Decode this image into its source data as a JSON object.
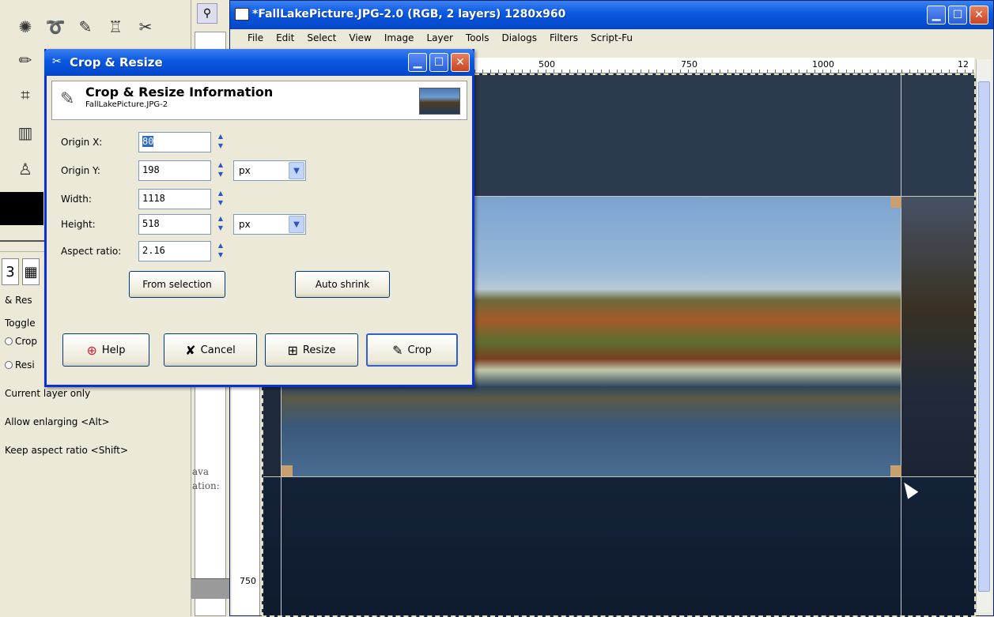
{
  "image_window": {
    "title": "*FallLakePicture.JPG-2.0 (RGB, 2 layers) 1280x960",
    "menu": [
      "File",
      "Edit",
      "Select",
      "View",
      "Image",
      "Layer",
      "Tools",
      "Dialogs",
      "Filters",
      "Script-Fu"
    ],
    "ruler_h": [
      "500",
      "750",
      "1000",
      "12"
    ],
    "ruler_v": "750"
  },
  "toolbox": {
    "tool_options": {
      "tab_label": "& Res",
      "toggle_label": "Toggle",
      "crop_label": "Crop",
      "resize_label": "Resi",
      "current_layer_only": "Current layer only",
      "allow_enlarging": "Allow enlarging  <Alt>",
      "keep_aspect": "Keep aspect ratio  <Shift>"
    }
  },
  "side_fragments": {
    "line1": "ava",
    "line2": "ation:"
  },
  "dialog": {
    "title": "Crop & Resize",
    "header_title": "Crop & Resize Information",
    "header_subtitle": "FallLakePicture.JPG-2",
    "fields": [
      {
        "label": "Origin X:",
        "value": "80"
      },
      {
        "label": "Origin Y:",
        "value": "198",
        "unit": "px"
      },
      {
        "label": "Width:",
        "value": "1118"
      },
      {
        "label": "Height:",
        "value": "518",
        "unit": "px"
      },
      {
        "label": "Aspect ratio:",
        "value": "2.16"
      }
    ],
    "buttons": {
      "from_selection": "From selection",
      "auto_shrink": "Auto shrink",
      "help": "Help",
      "cancel": "Cancel",
      "resize": "Resize",
      "crop": "Crop"
    }
  },
  "colors": {
    "titlebar": "#0a58e0",
    "close": "#c94426",
    "canvas_bg": "#1e2a3c"
  }
}
